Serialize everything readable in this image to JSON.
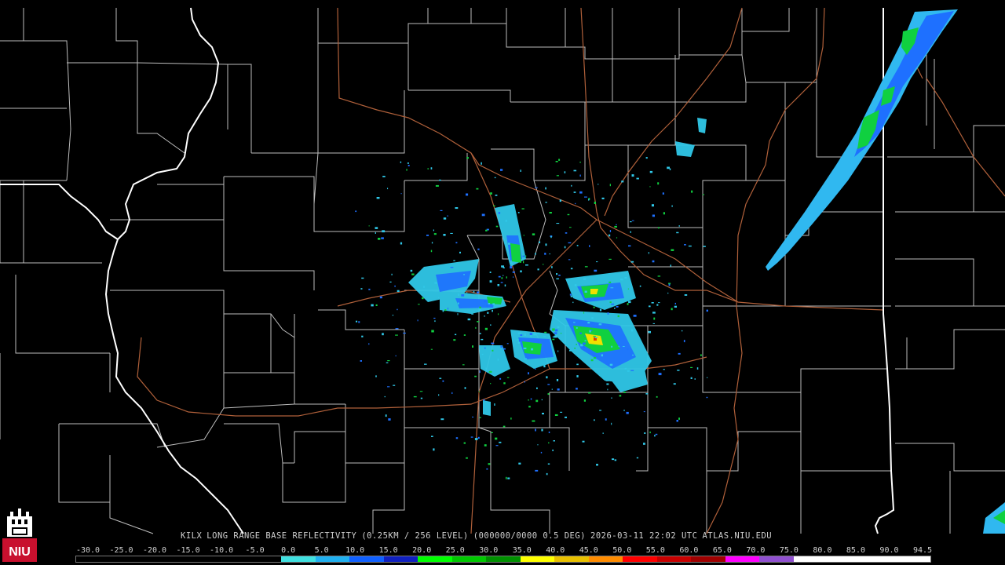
{
  "product": {
    "station": "KILX",
    "title": "LONG RANGE BASE REFLECTIVITY",
    "resolution": "(0.25KM / 256 LEVEL)",
    "scan": "(000000/0000 0.5 DEG)",
    "datetime": "2026-03-11 22:02 UTC",
    "source": "ATLAS.NIU.EDU"
  },
  "logo": {
    "text": "NIU",
    "color": "#c8102e",
    "icon": "castle-tower-icon"
  },
  "colorscale": {
    "ticks": [
      "-30.0",
      "-25.0",
      "-20.0",
      "-15.0",
      "-10.0",
      "-5.0",
      "0.0",
      "5.0",
      "10.0",
      "15.0",
      "20.0",
      "25.0",
      "30.0",
      "35.0",
      "40.0",
      "45.0",
      "50.0",
      "55.0",
      "60.0",
      "65.0",
      "70.0",
      "75.0",
      "80.0",
      "85.0",
      "90.0",
      "94.5"
    ],
    "colors": [
      "#000000",
      "#000000",
      "#000000",
      "#000000",
      "#000000",
      "#000000",
      "#40e0e0",
      "#20b0f0",
      "#1060ff",
      "#1020c0",
      "#00ff00",
      "#00c800",
      "#009000",
      "#ffff00",
      "#e8c000",
      "#ff8c00",
      "#ff0000",
      "#c80000",
      "#a00000",
      "#ff00ff",
      "#9050d0",
      "#ffffff",
      "#ffffff",
      "#ffffff",
      "#ffffff"
    ]
  },
  "colors": {
    "background": "#000000",
    "county_lines": "#c8c8c8",
    "state_lines": "#ffffff",
    "highways": "#b4603c"
  }
}
